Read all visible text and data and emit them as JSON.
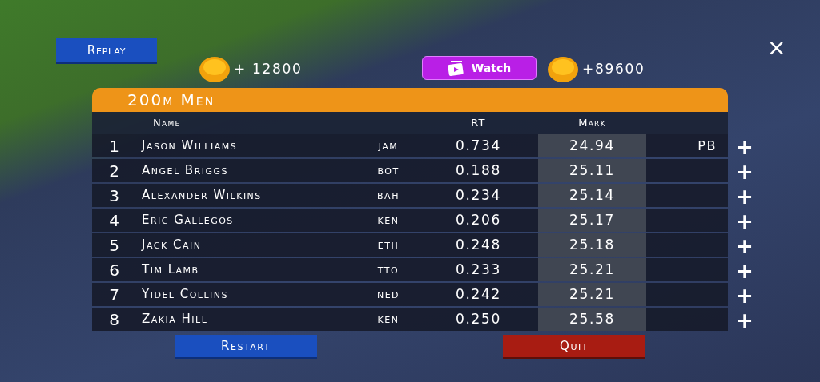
{
  "replay_button": "Replay",
  "coins_earned": "+ 12800",
  "watch_button": "Watch",
  "coins_bonus": "+89600",
  "close_button": "×",
  "results": {
    "title": "200m Men",
    "columns": [
      "Name",
      "RT",
      "Mark"
    ],
    "rows": [
      {
        "rank": "1",
        "name": "Jason Williams",
        "country": "jam",
        "rt": "0.734",
        "mark": "24.94",
        "badge": "PB",
        "add": "+"
      },
      {
        "rank": "2",
        "name": "Angel Briggs",
        "country": "bot",
        "rt": "0.188",
        "mark": "25.11",
        "add": "+"
      },
      {
        "rank": "3",
        "name": "Alexander Wilkins",
        "country": "bah",
        "rt": "0.234",
        "mark": "25.14",
        "add": "+"
      },
      {
        "rank": "4",
        "name": "Eric Gallegos",
        "country": "ken",
        "rt": "0.206",
        "mark": "25.17",
        "add": "+"
      },
      {
        "rank": "5",
        "name": "Jack Cain",
        "country": "eth",
        "rt": "0.248",
        "mark": "25.18",
        "add": "+"
      },
      {
        "rank": "6",
        "name": "Tim Lamb",
        "country": "tto",
        "rt": "0.233",
        "mark": "25.21",
        "add": "+"
      },
      {
        "rank": "7",
        "name": "Yidel Collins",
        "country": "ned",
        "rt": "0.242",
        "mark": "25.21",
        "add": "+"
      },
      {
        "rank": "8",
        "name": "Zakia Hill",
        "country": "ken",
        "rt": "0.250",
        "mark": "25.58",
        "add": "+"
      }
    ]
  },
  "restart_button": "Restart",
  "quit_button": "Quit"
}
